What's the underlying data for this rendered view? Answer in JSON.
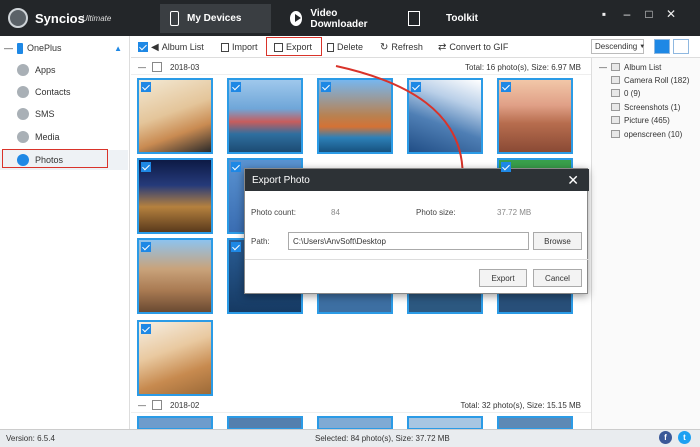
{
  "app": {
    "name": "Syncios",
    "edition": "Ultimate"
  },
  "nav": {
    "my_devices": "My Devices",
    "video_downloader": "Video Downloader",
    "toolkit": "Toolkit"
  },
  "window": {
    "menu_icon": "menu-icon",
    "minimize_icon": "minimize-icon",
    "maximize_icon": "maximize-icon",
    "close_icon": "close-icon"
  },
  "sidebar": {
    "device_name": "OnePlus",
    "items": [
      {
        "label": "Apps",
        "icon": "apps-icon"
      },
      {
        "label": "Contacts",
        "icon": "contacts-icon"
      },
      {
        "label": "SMS",
        "icon": "sms-icon"
      },
      {
        "label": "Media",
        "icon": "media-icon"
      },
      {
        "label": "Photos",
        "icon": "photos-icon"
      }
    ]
  },
  "toolbar": {
    "album_list": "Album List",
    "import": "Import",
    "export": "Export",
    "delete": "Delete",
    "refresh": "Refresh",
    "convert": "Convert to GIF",
    "sort": "Descending"
  },
  "groups": [
    {
      "date": "2018-03",
      "total": "Total: 16 photo(s), Size: 6.97 MB"
    },
    {
      "date": "2018-02",
      "total": "Total: 32 photo(s), Size: 15.15 MB"
    }
  ],
  "album_list": {
    "title": "Album List",
    "items": [
      "Camera Roll (182)",
      "0 (9)",
      "Screenshots (1)",
      "Picture (465)",
      "openscreen (10)"
    ]
  },
  "dialog": {
    "title": "Export Photo",
    "photo_count_label": "Photo count:",
    "photo_count": "84",
    "photo_size_label": "Photo size:",
    "photo_size": "37.72 MB",
    "path_label": "Path:",
    "path_value": "C:\\Users\\AnvSoft\\Desktop",
    "browse": "Browse",
    "export": "Export",
    "cancel": "Cancel"
  },
  "status": {
    "version": "Version: 6.5.4",
    "selected": "Selected: 84 photo(s), Size: 37.72 MB"
  },
  "colors": {
    "accent": "#1e88e5",
    "titlebar": "#232629",
    "highlight": "#d9332a"
  }
}
